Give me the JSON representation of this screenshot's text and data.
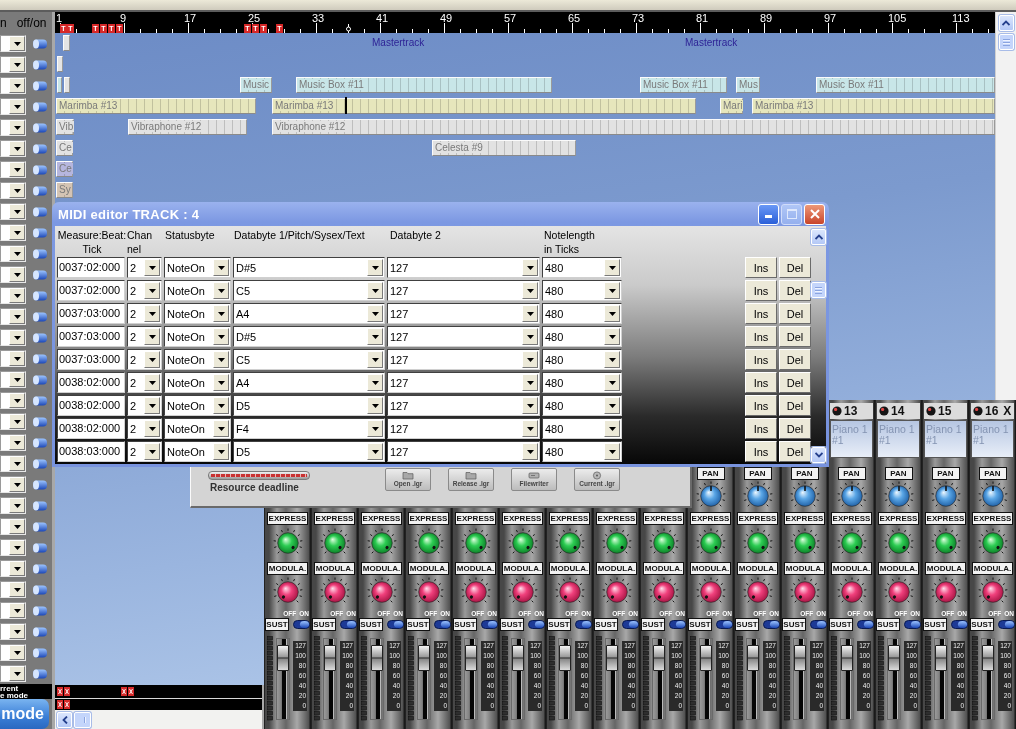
{
  "track_list": {
    "header": [
      "n",
      "off/on"
    ],
    "rows": [
      {
        "on": true
      },
      {
        "on": true
      },
      {
        "on": true
      },
      {
        "on": true
      },
      {
        "on": true
      },
      {
        "on": true
      },
      {
        "on": true
      },
      {
        "on": true
      },
      {
        "on": true
      },
      {
        "on": true
      },
      {
        "on": true
      },
      {
        "on": true
      },
      {
        "on": true
      },
      {
        "on": true
      },
      {
        "on": true
      },
      {
        "on": true
      },
      {
        "on": true
      },
      {
        "on": true
      },
      {
        "on": true
      },
      {
        "on": true
      },
      {
        "on": true
      },
      {
        "on": true
      },
      {
        "on": true
      },
      {
        "on": true
      },
      {
        "on": true
      },
      {
        "on": true
      },
      {
        "on": true
      },
      {
        "on": true
      },
      {
        "on": true
      },
      {
        "on": true
      },
      {
        "on": true
      }
    ],
    "mode_caption": [
      "rrent",
      "e mode"
    ],
    "mode_button": "mode"
  },
  "timeline": {
    "ruler_numbers": [
      "1",
      "9",
      "17",
      "25",
      "33",
      "41",
      "49",
      "57",
      "65",
      "73",
      "81",
      "89",
      "97",
      "105",
      "113"
    ],
    "markers": [
      "T",
      "T",
      "T",
      "T",
      "T",
      "T",
      "T",
      "T",
      "T",
      "T"
    ],
    "lanes": [
      {
        "labels": [
          "Mastertrack",
          "Mastertrack"
        ],
        "clips": [
          {
            "color": "#e4e4e4"
          }
        ]
      },
      {
        "clips": [
          {
            "color": "#e4e4e4"
          }
        ]
      },
      {
        "clips": [
          {
            "color": "#c8e6e8"
          },
          {
            "color": "#e4e4e4"
          },
          {
            "label": "Music",
            "color": "#c8e6e8"
          },
          {
            "label": "Music Box #11",
            "color": "#c8e6e8"
          },
          {
            "label": "Music Box #11",
            "color": "#c8e6e8"
          },
          {
            "label": "Mus",
            "color": "#c8e6e8"
          },
          {
            "label": "Music Box #11",
            "color": "#c8e6e8"
          }
        ]
      },
      {
        "clips": [
          {
            "label": "Marimba #13",
            "color": "#e6e6bc"
          },
          {
            "label": "Marimba #13",
            "color": "#e6e6bc"
          },
          {
            "label": "Mari",
            "color": "#e6e6bc"
          },
          {
            "label": "Marimba #13",
            "color": "#e6e6bc"
          }
        ]
      },
      {
        "clips": [
          {
            "label": "Vib",
            "color": "#e2e2e2"
          },
          {
            "label": "Vibraphone #12",
            "color": "#e2e2e2"
          },
          {
            "label": "Vibraphone #12",
            "color": "#e2e2e2"
          }
        ]
      },
      {
        "clips": [
          {
            "label": "Ce",
            "color": "#e2e2e2"
          },
          {
            "label": "Celesta #9",
            "color": "#e2e2e2"
          }
        ]
      },
      {
        "clips": [
          {
            "label": "Ce",
            "color": "#b6b6de"
          }
        ]
      },
      {
        "clips": [
          {
            "label": "Sy",
            "color": "#d4c4b4"
          }
        ]
      }
    ]
  },
  "midi_editor": {
    "title": "MIDI editor TRACK : 4",
    "columns": [
      [
        "Measure:Beat:",
        "Tick"
      ],
      [
        "Chan",
        "nel"
      ],
      [
        "Statusbyte"
      ],
      [
        "Databyte 1/Pitch/Sysex/Text"
      ],
      [
        "Databyte 2"
      ],
      [
        "Notelength",
        "in Ticks"
      ]
    ],
    "rows": [
      {
        "time": "0037:02:000",
        "channel": "2",
        "status": "NoteOn",
        "data1": "D#5",
        "data2": "127",
        "length": "480",
        "insert": "Ins",
        "delete": "Del"
      },
      {
        "time": "0037:02:000",
        "channel": "2",
        "status": "NoteOn",
        "data1": "C5",
        "data2": "127",
        "length": "480",
        "insert": "Ins",
        "delete": "Del"
      },
      {
        "time": "0037:03:000",
        "channel": "2",
        "status": "NoteOn",
        "data1": "A4",
        "data2": "127",
        "length": "480",
        "insert": "Ins",
        "delete": "Del"
      },
      {
        "time": "0037:03:000",
        "channel": "2",
        "status": "NoteOn",
        "data1": "D#5",
        "data2": "127",
        "length": "480",
        "insert": "Ins",
        "delete": "Del"
      },
      {
        "time": "0037:03:000",
        "channel": "2",
        "status": "NoteOn",
        "data1": "C5",
        "data2": "127",
        "length": "480",
        "insert": "Ins",
        "delete": "Del"
      },
      {
        "time": "0038:02:000",
        "channel": "2",
        "status": "NoteOn",
        "data1": "A4",
        "data2": "127",
        "length": "480",
        "insert": "Ins",
        "delete": "Del"
      },
      {
        "time": "0038:02:000",
        "channel": "2",
        "status": "NoteOn",
        "data1": "D5",
        "data2": "127",
        "length": "480",
        "insert": "Ins",
        "delete": "Del"
      },
      {
        "time": "0038:02:000",
        "channel": "2",
        "status": "NoteOn",
        "data1": "F4",
        "data2": "127",
        "length": "480",
        "insert": "Ins",
        "delete": "Del"
      },
      {
        "time": "0038:03:000",
        "channel": "2",
        "status": "NoteOn",
        "data1": "D5",
        "data2": "127",
        "length": "480",
        "insert": "Ins",
        "delete": "Del"
      }
    ]
  },
  "resource_panel": {
    "meter": {
      "level": 1
    },
    "caption": "Resource deadline",
    "buttons": [
      "Open .lgr",
      "Release .lgr",
      "Filewriter",
      "Current .lgr"
    ]
  },
  "mixer": {
    "strips": [
      {
        "express": {
          "label": "EXPRESS"
        },
        "modulation": {
          "label": "MODULA."
        },
        "switch_labels": [
          "OFF",
          "ON"
        ],
        "sustain": {
          "label": "SUST",
          "on": true
        },
        "fader": {
          "level": 0.9,
          "scale": [
            "127",
            "100",
            "80",
            "60",
            "40",
            "20",
            "0"
          ]
        }
      },
      {
        "express": {
          "label": "EXPRESS"
        },
        "modulation": {
          "label": "MODULA."
        },
        "switch_labels": [
          "OFF",
          "ON"
        ],
        "sustain": {
          "label": "SUST",
          "on": true
        },
        "fader": {
          "level": 0.9,
          "scale": [
            "127",
            "100",
            "80",
            "60",
            "40",
            "20",
            "0"
          ]
        }
      },
      {
        "express": {
          "label": "EXPRESS"
        },
        "modulation": {
          "label": "MODULA."
        },
        "switch_labels": [
          "OFF",
          "ON"
        ],
        "sustain": {
          "label": "SUST",
          "on": true
        },
        "fader": {
          "level": 0.9,
          "scale": [
            "127",
            "100",
            "80",
            "60",
            "40",
            "20",
            "0"
          ]
        }
      },
      {
        "express": {
          "label": "EXPRESS"
        },
        "modulation": {
          "label": "MODULA."
        },
        "switch_labels": [
          "OFF",
          "ON"
        ],
        "sustain": {
          "label": "SUST",
          "on": true
        },
        "fader": {
          "level": 0.9,
          "scale": [
            "127",
            "100",
            "80",
            "60",
            "40",
            "20",
            "0"
          ]
        }
      },
      {
        "express": {
          "label": "EXPRESS"
        },
        "modulation": {
          "label": "MODULA."
        },
        "switch_labels": [
          "OFF",
          "ON"
        ],
        "sustain": {
          "label": "SUST",
          "on": true
        },
        "fader": {
          "level": 0.9,
          "scale": [
            "127",
            "100",
            "80",
            "60",
            "40",
            "20",
            "0"
          ]
        }
      },
      {
        "express": {
          "label": "EXPRESS"
        },
        "modulation": {
          "label": "MODULA."
        },
        "switch_labels": [
          "OFF",
          "ON"
        ],
        "sustain": {
          "label": "SUST",
          "on": true
        },
        "fader": {
          "level": 0.9,
          "scale": [
            "127",
            "100",
            "80",
            "60",
            "40",
            "20",
            "0"
          ]
        }
      },
      {
        "express": {
          "label": "EXPRESS"
        },
        "modulation": {
          "label": "MODULA."
        },
        "switch_labels": [
          "OFF",
          "ON"
        ],
        "sustain": {
          "label": "SUST",
          "on": true
        },
        "fader": {
          "level": 0.9,
          "scale": [
            "127",
            "100",
            "80",
            "60",
            "40",
            "20",
            "0"
          ]
        }
      },
      {
        "express": {
          "label": "EXPRESS"
        },
        "modulation": {
          "label": "MODULA."
        },
        "switch_labels": [
          "OFF",
          "ON"
        ],
        "sustain": {
          "label": "SUST",
          "on": true
        },
        "fader": {
          "level": 0.9,
          "scale": [
            "127",
            "100",
            "80",
            "60",
            "40",
            "20",
            "0"
          ]
        }
      },
      {
        "express": {
          "label": "EXPRESS"
        },
        "modulation": {
          "label": "MODULA."
        },
        "switch_labels": [
          "OFF",
          "ON"
        ],
        "sustain": {
          "label": "SUST",
          "on": true
        },
        "fader": {
          "level": 0.9,
          "scale": [
            "127",
            "100",
            "80",
            "60",
            "40",
            "20",
            "0"
          ]
        }
      },
      {
        "pan": {
          "label": "PAN"
        },
        "express": {
          "label": "EXPRESS"
        },
        "modulation": {
          "label": "MODULA."
        },
        "switch_labels": [
          "OFF",
          "ON"
        ],
        "sustain": {
          "label": "SUST",
          "on": true
        },
        "fader": {
          "level": 0.9,
          "scale": [
            "127",
            "100",
            "80",
            "60",
            "40",
            "20",
            "0"
          ]
        }
      },
      {
        "pan": {
          "label": "PAN"
        },
        "express": {
          "label": "EXPRESS"
        },
        "modulation": {
          "label": "MODULA."
        },
        "switch_labels": [
          "OFF",
          "ON"
        ],
        "sustain": {
          "label": "SUST",
          "on": true
        },
        "fader": {
          "level": 0.9,
          "scale": [
            "127",
            "100",
            "80",
            "60",
            "40",
            "20",
            "0"
          ]
        }
      },
      {
        "pan": {
          "label": "PAN"
        },
        "express": {
          "label": "EXPRESS"
        },
        "modulation": {
          "label": "MODULA."
        },
        "switch_labels": [
          "OFF",
          "ON"
        ],
        "sustain": {
          "label": "SUST",
          "on": true
        },
        "fader": {
          "level": 0.9,
          "scale": [
            "127",
            "100",
            "80",
            "60",
            "40",
            "20",
            "0"
          ]
        }
      },
      {
        "number": "13",
        "name": "Piano 1 #1",
        "pan": {
          "label": "PAN"
        },
        "express": {
          "label": "EXPRESS"
        },
        "modulation": {
          "label": "MODULA."
        },
        "switch_labels": [
          "OFF",
          "ON"
        ],
        "sustain": {
          "label": "SUST",
          "on": true
        },
        "fader": {
          "level": 0.9,
          "scale": [
            "127",
            "100",
            "80",
            "60",
            "40",
            "20",
            "0"
          ]
        }
      },
      {
        "number": "14",
        "name": "Piano 1 #1",
        "pan": {
          "label": "PAN"
        },
        "express": {
          "label": "EXPRESS"
        },
        "modulation": {
          "label": "MODULA."
        },
        "switch_labels": [
          "OFF",
          "ON"
        ],
        "sustain": {
          "label": "SUST",
          "on": true
        },
        "fader": {
          "level": 0.9,
          "scale": [
            "127",
            "100",
            "80",
            "60",
            "40",
            "20",
            "0"
          ]
        }
      },
      {
        "number": "15",
        "name": "Piano 1 #1",
        "pan": {
          "label": "PAN"
        },
        "express": {
          "label": "EXPRESS"
        },
        "modulation": {
          "label": "MODULA."
        },
        "switch_labels": [
          "OFF",
          "ON"
        ],
        "sustain": {
          "label": "SUST",
          "on": true
        },
        "fader": {
          "level": 0.9,
          "scale": [
            "127",
            "100",
            "80",
            "60",
            "40",
            "20",
            "0"
          ]
        }
      },
      {
        "number": "16",
        "close": "X",
        "name": "Piano 1 #1",
        "pan": {
          "label": "PAN"
        },
        "express": {
          "label": "EXPRESS"
        },
        "modulation": {
          "label": "MODULA."
        },
        "switch_labels": [
          "OFF",
          "ON"
        ],
        "sustain": {
          "label": "SUST",
          "on": true
        },
        "fader": {
          "level": 0.9,
          "scale": [
            "127",
            "100",
            "80",
            "60",
            "40",
            "20",
            "0"
          ]
        }
      }
    ]
  }
}
